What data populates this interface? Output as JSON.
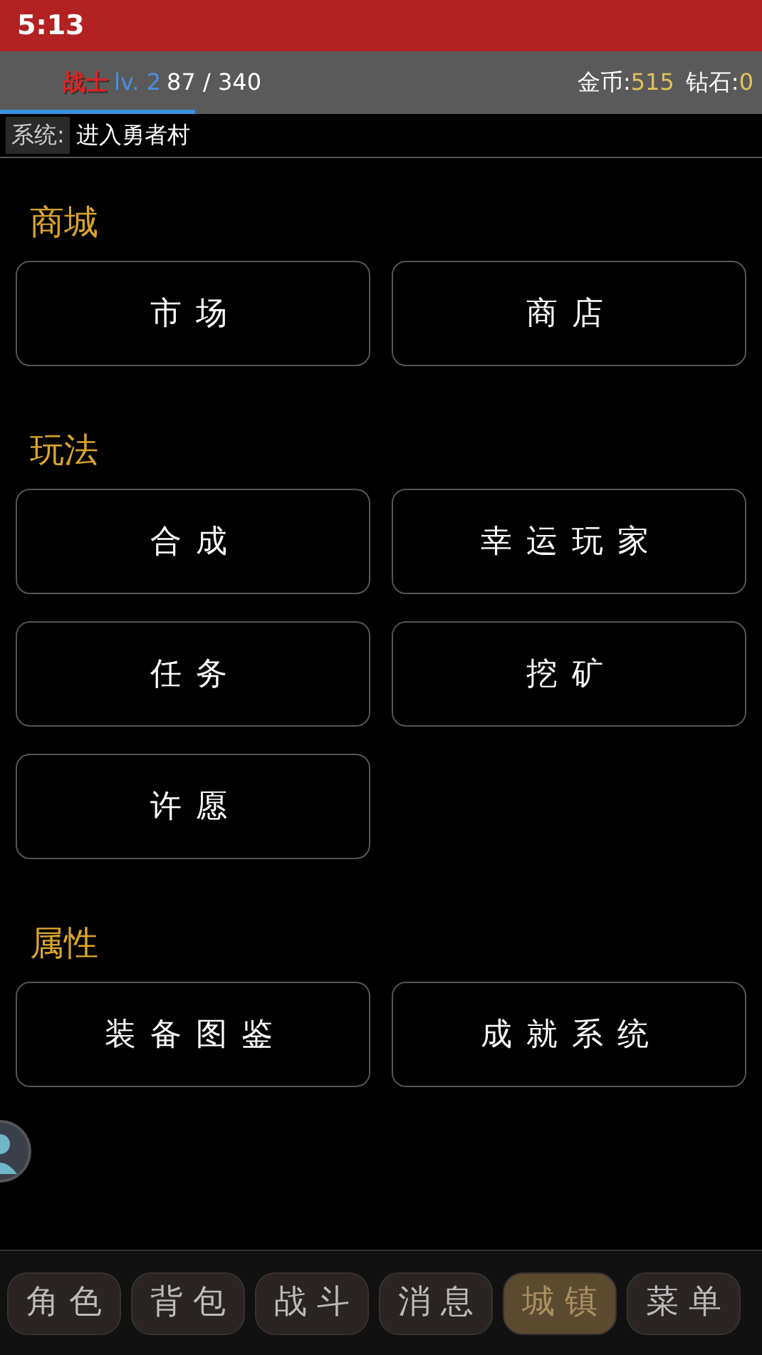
{
  "status_bar": {
    "time": "5:13"
  },
  "player": {
    "class": "战士",
    "level": "lv. 2",
    "exp": "87 / 340",
    "exp_progress": {
      "level": 0.256
    },
    "gold_label": "金币:",
    "gold": "515",
    "diamond_label": "钻石:",
    "diamond": "0"
  },
  "system_message": {
    "label": "系统:",
    "text": "进入勇者村"
  },
  "sections": [
    {
      "title": "商城",
      "buttons": [
        "市场",
        "商店"
      ]
    },
    {
      "title": "玩法",
      "buttons": [
        "合成",
        "幸运玩家",
        "任务",
        "挖矿",
        "许愿"
      ]
    },
    {
      "title": "属性",
      "buttons": [
        "装备图鉴",
        "成就系统"
      ]
    }
  ],
  "bottom_nav": [
    {
      "label": "角色",
      "selected": false
    },
    {
      "label": "背包",
      "selected": false
    },
    {
      "label": "战斗",
      "selected": false
    },
    {
      "label": "消息",
      "selected": false
    },
    {
      "label": "城镇",
      "selected": true
    },
    {
      "label": "菜单",
      "selected": false
    }
  ]
}
